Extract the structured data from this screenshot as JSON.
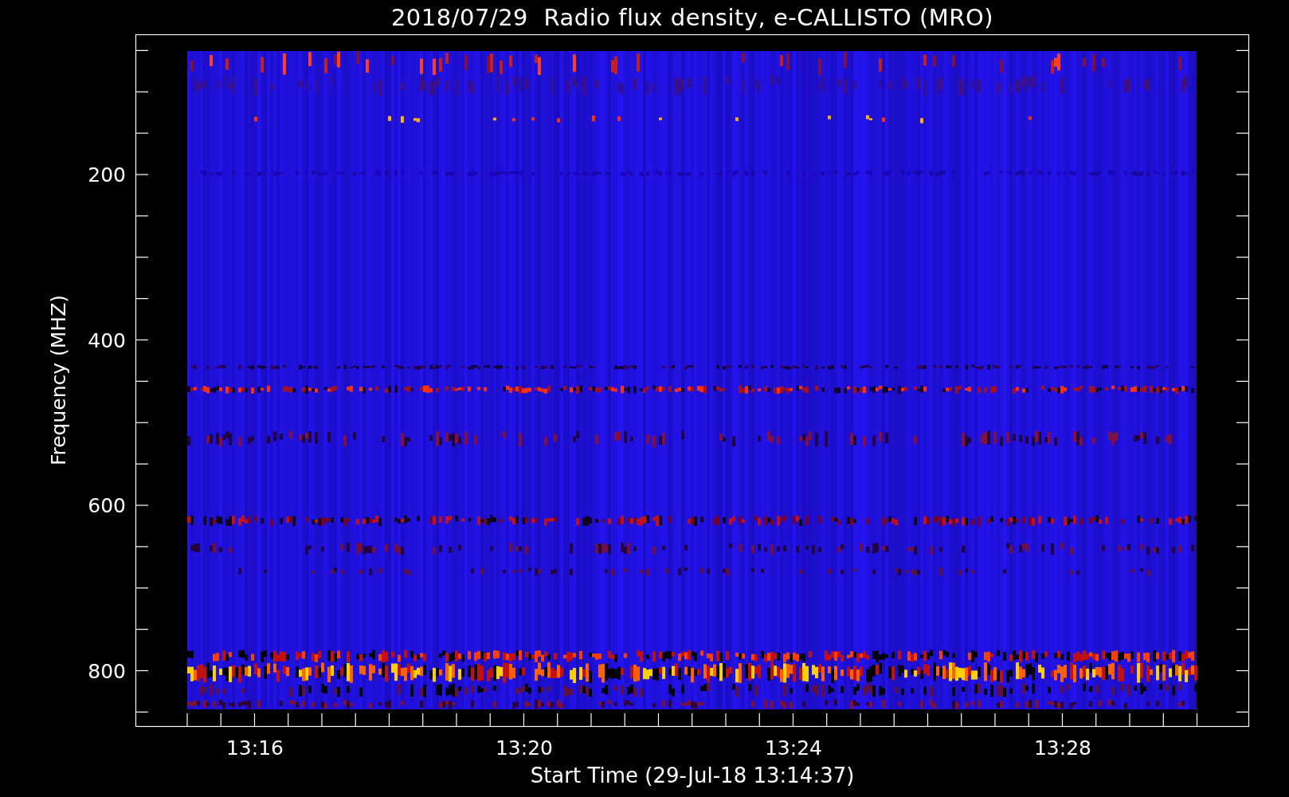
{
  "title": "2018/07/29  Radio flux density, e-CALLISTO (MRO)",
  "y_axis": {
    "label": "Frequency (MHZ)",
    "tick_labels": [
      "200",
      "400",
      "600",
      "800"
    ]
  },
  "x_axis": {
    "label": "Start Time (29-Jul-18 13:14:37)",
    "tick_labels": [
      "13:16",
      "13:20",
      "13:24",
      "13:28"
    ]
  }
}
